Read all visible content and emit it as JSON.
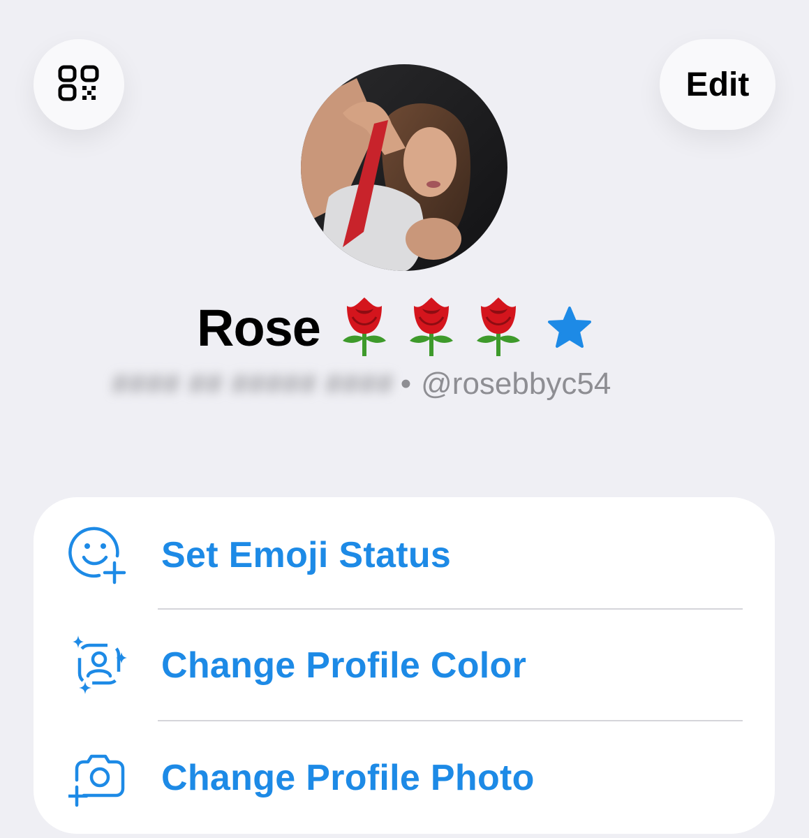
{
  "header": {
    "edit_label": "Edit",
    "qr_icon": "qr-code-icon"
  },
  "profile": {
    "name": "Rose",
    "emoji_status": [
      "🌹",
      "🌹",
      "🌹"
    ],
    "premium_icon": "star-icon",
    "blurred_text": "#### ## ##### ####",
    "separator": "•",
    "username": "@rosebbyc54"
  },
  "menu": {
    "items": [
      {
        "label": "Set Emoji Status",
        "icon": "emoji-status-icon"
      },
      {
        "label": "Change Profile Color",
        "icon": "profile-color-icon"
      },
      {
        "label": "Change Profile Photo",
        "icon": "camera-add-icon"
      }
    ]
  },
  "colors": {
    "accent": "#1d8ae6",
    "background": "#efeff4",
    "card": "#ffffff",
    "secondary_text": "#8e8e93",
    "rose_red": "#d4151d",
    "rose_green": "#3e9a2b"
  }
}
